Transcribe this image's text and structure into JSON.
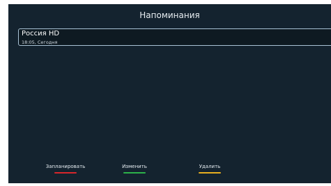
{
  "header": {
    "title": "Напоминания"
  },
  "reminders": [
    {
      "channel": "Россия HD",
      "time": "18:05, Сегодня"
    }
  ],
  "actions": [
    {
      "label": "Запланировать",
      "color": "#d9262b"
    },
    {
      "label": "Изменить",
      "color": "#2db34a"
    },
    {
      "label": "Удалить",
      "color": "#e8b020"
    }
  ]
}
